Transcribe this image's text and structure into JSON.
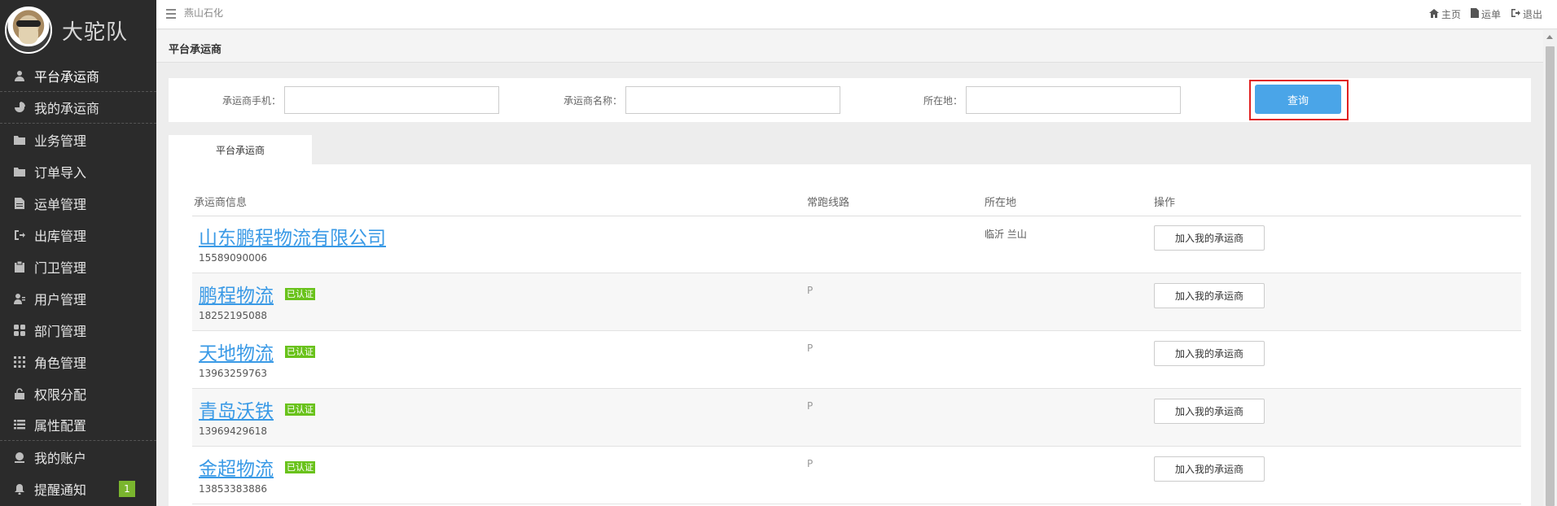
{
  "brand": {
    "name": "大驼队"
  },
  "sidebar": {
    "items": [
      {
        "label": "平台承运商",
        "icon": "user-icon"
      },
      {
        "label": "我的承运商",
        "icon": "pie-chart-icon"
      },
      {
        "label": "业务管理",
        "icon": "folder-icon"
      },
      {
        "label": "订单导入",
        "icon": "folder-icon"
      },
      {
        "label": "运单管理",
        "icon": "document-icon"
      },
      {
        "label": "出库管理",
        "icon": "sign-out-icon"
      },
      {
        "label": "门卫管理",
        "icon": "clipboard-icon"
      },
      {
        "label": "用户管理",
        "icon": "user-list-icon"
      },
      {
        "label": "部门管理",
        "icon": "grid-icon"
      },
      {
        "label": "角色管理",
        "icon": "dots-grid-icon"
      },
      {
        "label": "权限分配",
        "icon": "lock-icon"
      },
      {
        "label": "属性配置",
        "icon": "list-icon"
      },
      {
        "label": "我的账户",
        "icon": "account-icon"
      },
      {
        "label": "提醒通知",
        "icon": "bell-icon",
        "badge": "1"
      }
    ]
  },
  "topbar": {
    "company": "燕山石化",
    "links": [
      {
        "label": "主页",
        "icon": "home-icon"
      },
      {
        "label": "运单",
        "icon": "file-icon"
      },
      {
        "label": "退出",
        "icon": "logout-icon"
      }
    ]
  },
  "page": {
    "title": "平台承运商"
  },
  "search": {
    "phone_label": "承运商手机：",
    "phone_value": "",
    "name_label": "承运商名称：",
    "name_value": "",
    "location_label": "所在地：",
    "location_value": "",
    "query_label": "查询"
  },
  "tabs": [
    {
      "label": "平台承运商"
    }
  ],
  "table": {
    "headers": {
      "info": "承运商信息",
      "route": "常跑线路",
      "location": "所在地",
      "action": "操作"
    },
    "rows": [
      {
        "name": "山东鹏程物流有限公司",
        "verified": "",
        "phone": "15589090006",
        "route": "",
        "location": "临沂 兰山",
        "action": "加入我的承运商"
      },
      {
        "name": "鹏程物流",
        "verified": "已认证",
        "phone": "18252195088",
        "route": "P",
        "location": "",
        "action": "加入我的承运商"
      },
      {
        "name": "天地物流",
        "verified": "已认证",
        "phone": "13963259763",
        "route": "P",
        "location": "",
        "action": "加入我的承运商"
      },
      {
        "name": "青岛沃铁",
        "verified": "已认证",
        "phone": "13969429618",
        "route": "P",
        "location": "",
        "action": "加入我的承运商"
      },
      {
        "name": "金超物流",
        "verified": "已认证",
        "phone": "13853383886",
        "route": "P",
        "location": "",
        "action": "加入我的承运商"
      }
    ]
  },
  "colors": {
    "sidebar_bg": "#2b2b2b",
    "accent": "#4aa5e8",
    "link": "#3a9ae6",
    "verified": "#69c21b",
    "highlight": "#e02020"
  }
}
